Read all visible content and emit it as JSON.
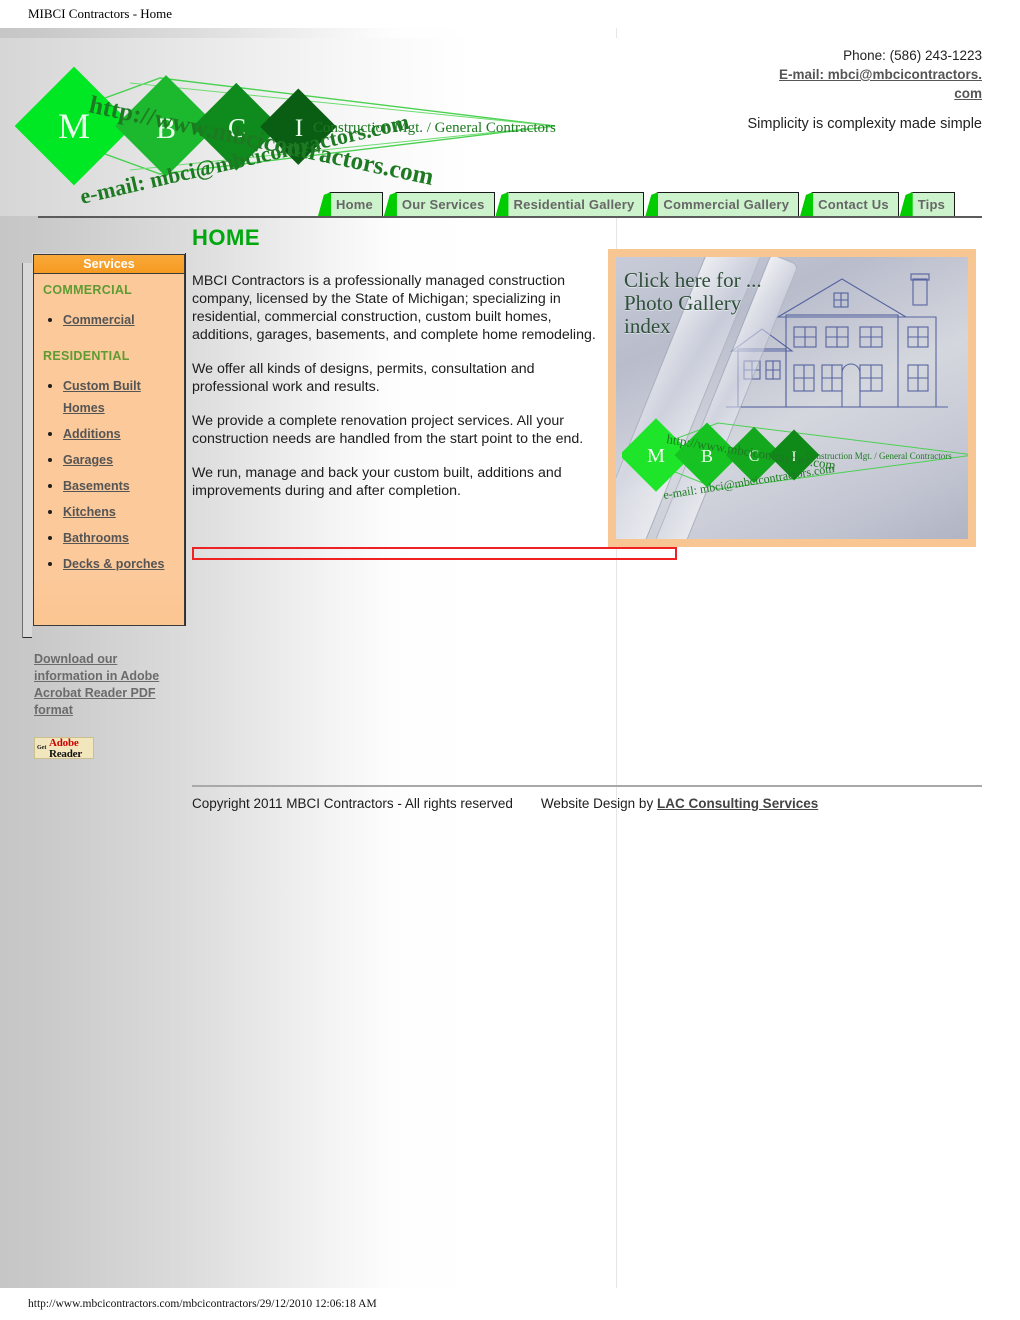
{
  "window": {
    "document_title": "MIBCI Contractors - Home",
    "status_bar_text": "http://www.mbcicontractors.com/mbcicontractors/29/12/2010 12:06:18 AM"
  },
  "masthead": {
    "logo": {
      "url_top": "http://www.mbcicontractors.com",
      "url_bottom": "e-mail: mbci@mbcicontractors.com",
      "tagline": "Construction Mgt. / General Contractors",
      "letters": [
        "M",
        "B",
        "C",
        "I"
      ],
      "colors": [
        "#00e824",
        "#17b52c",
        "#0f8a1c",
        "#0a5e14"
      ]
    },
    "contact": {
      "phone_label": "Phone: (586) 243-1223",
      "email_line1": "E-mail: mbci@mbcicontractors.",
      "email_line2": "com"
    },
    "tagline": "Simplicity is complexity made simple"
  },
  "nav": {
    "tabs": [
      {
        "label": "Home",
        "active": true
      },
      {
        "label": "Our Services",
        "active": false
      },
      {
        "label": "Residential Gallery",
        "active": false
      },
      {
        "label": "Commercial Gallery",
        "active": false
      },
      {
        "label": "Contact Us",
        "active": false
      },
      {
        "label": "Tips",
        "active": false
      }
    ],
    "colors": {
      "wedge": "#00cc00",
      "body": "#cdf3cd",
      "text": "#666666"
    }
  },
  "main": {
    "heading": "HOME",
    "paragraphs": [
      "MBCI Contractors is a professionally managed construction company, licensed by the State of Michigan; specializing in residential, commercial construction, custom built homes, additions, garages, basements, and complete home remodeling.",
      "We offer all kinds of designs, permits, consultation and professional work and results.",
      "We provide a complete renovation project services. All your construction needs are handled from the start point to the end.",
      "We run, manage and back your custom built, additions and improvements during and after completion."
    ],
    "heading_color": "#00a80d"
  },
  "sidebar": {
    "header": "Services",
    "header_color": "#f59a21",
    "body_color": "#fcc99a",
    "groups": [
      {
        "title": "COMMERCIAL",
        "items": [
          "Commercial"
        ]
      },
      {
        "title": "RESIDENTIAL",
        "items": [
          "Custom Built Homes",
          "Additions",
          "Garages",
          "Basements",
          "Kitchens",
          "Bathrooms",
          "Decks & porches"
        ]
      }
    ]
  },
  "gallery": {
    "caption_line1": "Click here for ...",
    "caption_line2": "Photo Gallery",
    "caption_line3": "index",
    "border_color": "#f8c693",
    "logo": {
      "url_top": "http://www.mbcicontractors.com",
      "url_bottom": "e-mail: mbci@mbcicontractors.com",
      "tagline": "Construction Mgt. / General Contractors",
      "letters": [
        "M",
        "B",
        "C",
        "I"
      ]
    }
  },
  "pdf": {
    "link_line1": "Download our ",
    "link_line2": "information in Adobe ",
    "link_line3": "Acrobat Reader PDF ",
    "link_line4": "format",
    "badge_get": "Get",
    "badge_brand": "Adobe",
    "badge_product": "Reader"
  },
  "footer": {
    "copyright": "Copyright 2011 MBCI Contractors - All rights reserved",
    "design_prefix": "Website Design by ",
    "design_link": "LAC Consulting Services"
  }
}
